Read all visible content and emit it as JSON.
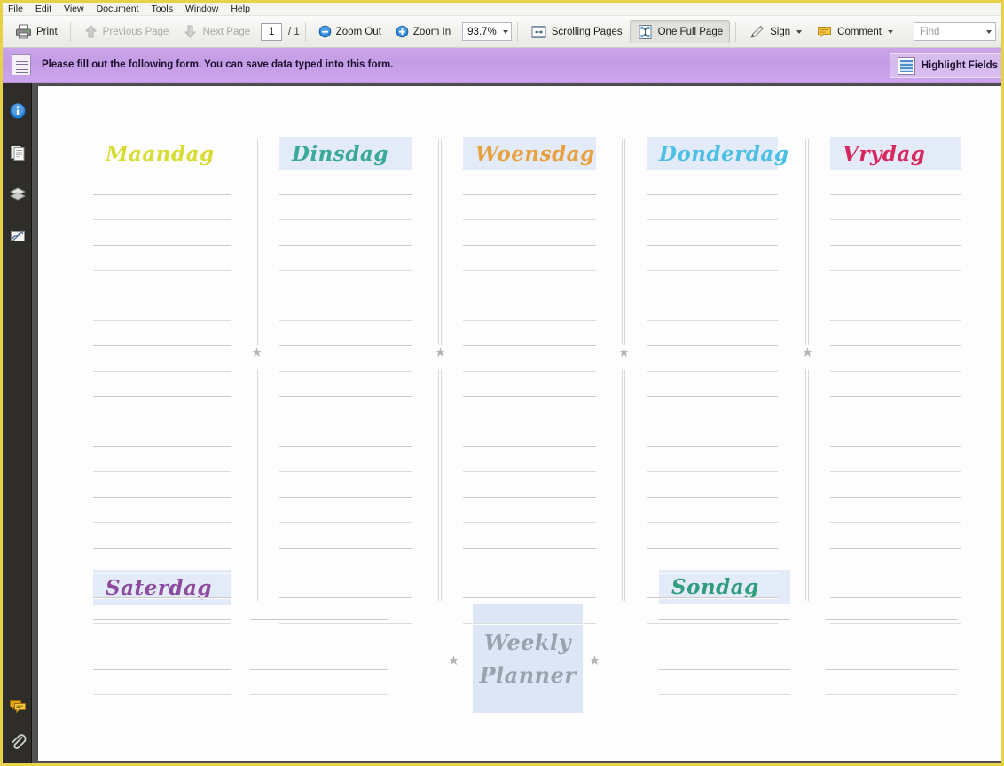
{
  "menu": {
    "items": [
      {
        "label": "File"
      },
      {
        "label": "Edit"
      },
      {
        "label": "View"
      },
      {
        "label": "Document"
      },
      {
        "label": "Tools"
      },
      {
        "label": "Window"
      },
      {
        "label": "Help"
      }
    ]
  },
  "toolbar": {
    "print_label": "Print",
    "previous_page_label": "Previous Page",
    "next_page_label": "Next Page",
    "page_number": "1",
    "page_total": "/ 1",
    "zoom_out_label": "Zoom Out",
    "zoom_in_label": "Zoom In",
    "zoom_value": "93.7%",
    "scrolling_pages_label": "Scrolling Pages",
    "one_full_page_label": "One Full Page",
    "sign_label": "Sign",
    "comment_label": "Comment",
    "find_placeholder": "Find",
    "icons": {
      "print": "printer-icon",
      "previous_page": "arrow-up-icon",
      "next_page": "arrow-down-icon",
      "zoom_out": "minus-circle-icon",
      "zoom_in": "plus-circle-icon",
      "scrolling_pages": "scrolling-pages-icon",
      "one_full_page": "one-full-page-icon",
      "sign": "pen-icon",
      "comment": "speech-bubble-icon",
      "dropdown": "chevron-down-icon"
    }
  },
  "notification": {
    "message": "Please fill out the following form. You can save data typed into this form.",
    "highlight_fields_label": "Highlight Fields",
    "icon": "form-document-icon",
    "background_color": "#c49ce6"
  },
  "sidebar": {
    "items": [
      {
        "name": "info-icon",
        "label": "Document Information"
      },
      {
        "name": "pages-icon",
        "label": "Pages"
      },
      {
        "name": "layers-icon",
        "label": "Layers"
      },
      {
        "name": "signatures-icon",
        "label": "Signatures"
      }
    ],
    "bottom_items": [
      {
        "name": "comments-icon",
        "label": "Comments"
      },
      {
        "name": "attachments-icon",
        "label": "Attachments"
      }
    ]
  },
  "document": {
    "title": "Weekly Planner",
    "title_lines": [
      "Weekly",
      "Planner"
    ],
    "title_color": "#9aa2ae",
    "title_field_background": "#dde6f7",
    "field_background": "#e3eaf8",
    "watermark": "",
    "days": [
      {
        "label": "Maandag",
        "color": "#d8dd33",
        "field": false,
        "has_caret": true,
        "lines": 18
      },
      {
        "label": "Dinsdag",
        "color": "#3aa89b",
        "field": true,
        "has_caret": false,
        "lines": 18
      },
      {
        "label": "Woensdag",
        "color": "#e8a13f",
        "field": true,
        "has_caret": false,
        "lines": 18
      },
      {
        "label": "Donderdag",
        "color": "#4bbfe4",
        "field": true,
        "has_caret": false,
        "lines": 18
      },
      {
        "label": "Vrydag",
        "color": "#d6275e",
        "field": true,
        "has_caret": false,
        "lines": 18
      }
    ],
    "weekend": [
      {
        "label": "Saterdag",
        "color": "#8e4ca0",
        "field": true,
        "lines": 4
      },
      {
        "label": "Sondag",
        "color": "#2f9d7e",
        "field": true,
        "lines": 4
      }
    ],
    "star_icon": "star-icon",
    "star_count": 6
  }
}
